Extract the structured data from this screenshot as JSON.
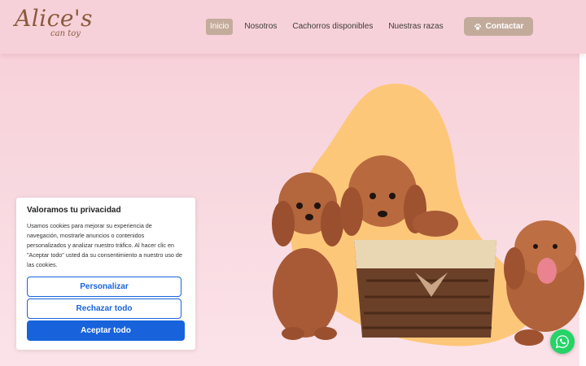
{
  "logo": {
    "main": "Alice's",
    "sub": "can toy"
  },
  "nav": {
    "items": [
      {
        "label": "Inicio",
        "active": true
      },
      {
        "label": "Nosotros",
        "active": false
      },
      {
        "label": "Cachorros disponibles",
        "active": false
      },
      {
        "label": "Nuestras razas",
        "active": false
      }
    ]
  },
  "header": {
    "contact_label": "Contactar",
    "contact_icon": "paw-icon"
  },
  "cookie": {
    "title": "Valoramos tu privacidad",
    "text": "Usamos cookies para mejorar su experiencia de navegación, mostrarle anuncios o contenidos personalizados y analizar nuestro tráfico. Al hacer clic en \"Aceptar todo\" usted da su consentimiento a nuestro uso de las cookies.",
    "customize_label": "Personalizar",
    "reject_label": "Rechazar todo",
    "accept_label": "Aceptar todo"
  },
  "floating": {
    "whatsapp_icon": "whatsapp-icon"
  },
  "colors": {
    "header_bg": "#f7d1d9",
    "accent_button": "#c2ab9b",
    "blob": "#fdc77a",
    "primary_blue": "#1863dc",
    "whatsapp": "#25d366"
  }
}
